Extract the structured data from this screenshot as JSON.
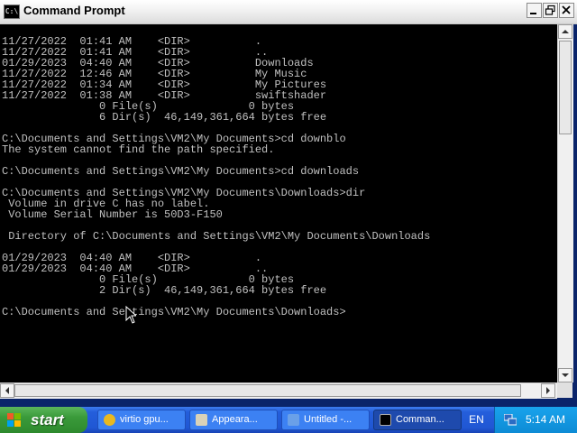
{
  "window": {
    "title": "Command Prompt",
    "icon_text": "C:\\",
    "minimize_icon": "minimize-icon",
    "maximize_icon": "maximize-icon",
    "close_icon": "close-icon"
  },
  "console": {
    "lines": [
      "11/27/2022  01:41 AM    <DIR>          .",
      "11/27/2022  01:41 AM    <DIR>          ..",
      "01/29/2023  04:40 AM    <DIR>          Downloads",
      "11/27/2022  12:46 AM    <DIR>          My Music",
      "11/27/2022  01:34 AM    <DIR>          My Pictures",
      "11/27/2022  01:38 AM    <DIR>          swiftshader",
      "               0 File(s)              0 bytes",
      "               6 Dir(s)  46,149,361,664 bytes free",
      "",
      "C:\\Documents and Settings\\VM2\\My Documents>cd downblo",
      "The system cannot find the path specified.",
      "",
      "C:\\Documents and Settings\\VM2\\My Documents>cd downloads",
      "",
      "C:\\Documents and Settings\\VM2\\My Documents\\Downloads>dir",
      " Volume in drive C has no label.",
      " Volume Serial Number is 50D3-F150",
      "",
      " Directory of C:\\Documents and Settings\\VM2\\My Documents\\Downloads",
      "",
      "01/29/2023  04:40 AM    <DIR>          .",
      "01/29/2023  04:40 AM    <DIR>          ..",
      "               0 File(s)              0 bytes",
      "               2 Dir(s)  46,149,361,664 bytes free",
      "",
      "C:\\Documents and Settings\\VM2\\My Documents\\Downloads>"
    ]
  },
  "taskbar": {
    "start_label": "start",
    "tasks": [
      {
        "label": "virtio gpu...",
        "icon": "chrome-icon",
        "color": "#e8b820"
      },
      {
        "label": "Appeara...",
        "icon": "display-properties-icon",
        "color": "#d9d2b8"
      },
      {
        "label": "Untitled -...",
        "icon": "paint-icon",
        "color": "#6aa0e8"
      },
      {
        "label": "Comman...",
        "icon": "command-prompt-icon",
        "color": "#000000"
      }
    ],
    "language": "EN",
    "clock": "5:14 AM"
  },
  "colors": {
    "console_bg": "#000000",
    "console_text": "#c0c0c0",
    "taskbar_blue": "#245edb",
    "start_green": "#3a9a3a"
  }
}
